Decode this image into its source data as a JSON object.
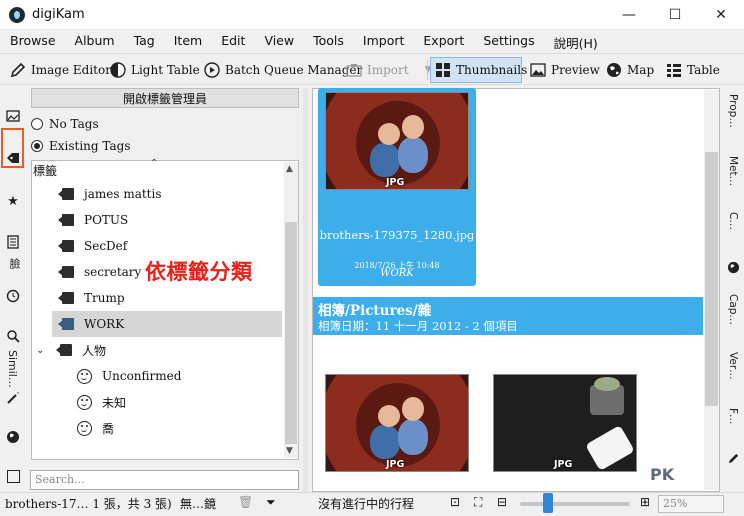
{
  "window": {
    "title": "digiKam",
    "minimize": "—",
    "maximize": "☐",
    "close": "✕"
  },
  "menu": [
    "Browse",
    "Album",
    "Tag",
    "Item",
    "Edit",
    "View",
    "Tools",
    "Import",
    "Export",
    "Settings",
    "說明(H)"
  ],
  "toolbar": {
    "image_editor": "Image Editor",
    "light_table": "Light Table",
    "batch_queue": "Batch Queue Manager",
    "import": "Import",
    "thumbnails": "Thumbnails",
    "preview": "Preview",
    "map": "Map",
    "table": "Table"
  },
  "left_strip": {
    "people_label": "臉",
    "similar_label": "Simil…"
  },
  "tags_panel": {
    "open_manager": "開啟標籤管理員",
    "no_tags": "No Tags",
    "existing_tags": "Existing Tags",
    "tree_header": "標籤",
    "tags": [
      "james mattis",
      "POTUS",
      "SecDef",
      "secretary",
      "Trump",
      "WORK"
    ],
    "people_node": "人物",
    "people": [
      "Unconfirmed",
      "未知",
      "喬"
    ],
    "search_placeholder": "Search..."
  },
  "overlay_caption": "依標籤分類",
  "main": {
    "card": {
      "badge": "JPG",
      "filename": "brothers-179375_1280.jpg",
      "date": "2018/7/26 上午 10:48",
      "tag": "WORK"
    },
    "album_title": "相簿/Pictures/雜",
    "album_subtitle": "相簿日期：11 十一月 2012 - 2 個項目",
    "thumb_badges": [
      "JPG",
      "JPG"
    ]
  },
  "right_strip": [
    "Prop…",
    "Met…",
    "C…",
    "Cap…",
    "Ver…",
    "F…"
  ],
  "status": {
    "file": "brothers-17… 1 張，共 3 張)",
    "filter": "無…鏡",
    "process": "沒有進行中的行程",
    "zoom": "25%",
    "zoom_fraction": 0.25
  },
  "watermark": "PK",
  "colors": {
    "selection": "#3daee9",
    "highlight_box": "#f05a28",
    "overlay_text": "#e82019"
  }
}
